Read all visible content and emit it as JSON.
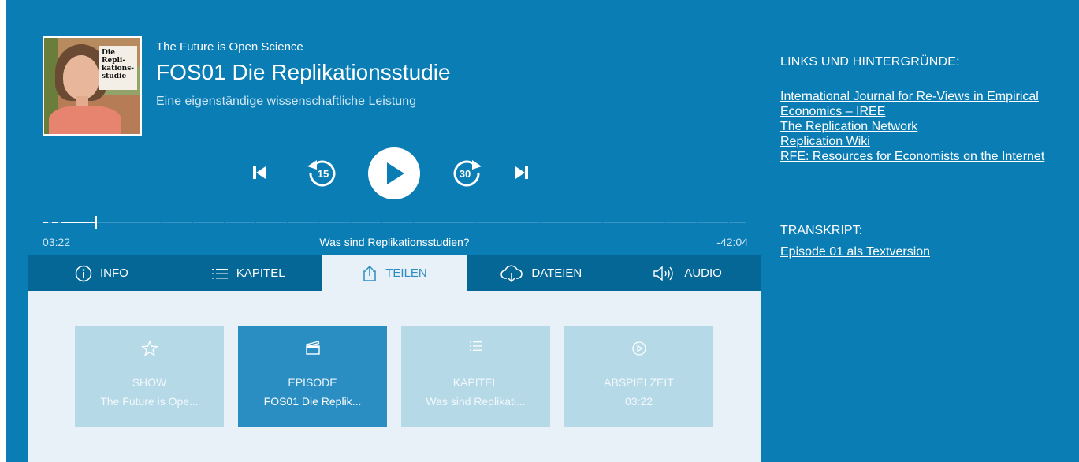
{
  "player": {
    "show_title": "The Future is Open Science",
    "episode_title": "FOS01 Die Replikationsstudie",
    "episode_subtitle": "Eine eigenständige wissenschaftliche Leistung",
    "cover_label": "Die Repli-kations-studie",
    "skip_back_seconds": "15",
    "skip_forward_seconds": "30",
    "progress": {
      "current_time": "03:22",
      "remaining_time": "-42:04",
      "chapter_title": "Was sind Replikationsstudien?",
      "played_fraction": 0.075
    },
    "tabs": [
      {
        "label": "INFO",
        "icon": "info-icon"
      },
      {
        "label": "KAPITEL",
        "icon": "list-icon"
      },
      {
        "label": "TEILEN",
        "icon": "share-icon",
        "active": true
      },
      {
        "label": "DATEIEN",
        "icon": "cloud-download-icon"
      },
      {
        "label": "AUDIO",
        "icon": "speaker-icon"
      }
    ],
    "share_cards": [
      {
        "label": "SHOW",
        "value": "The Future is Ope...",
        "icon": "star-icon"
      },
      {
        "label": "EPISODE",
        "value": "FOS01 Die Replik...",
        "icon": "clapperboard-icon",
        "active": true
      },
      {
        "label": "KAPITEL",
        "value": "Was sind Replikati...",
        "icon": "list-icon"
      },
      {
        "label": "ABSPIELZEIT",
        "value": "03:22",
        "icon": "play-circle-icon"
      }
    ]
  },
  "sidebar": {
    "links_heading": "LINKS UND HINTERGRÜNDE:",
    "links": [
      "International Journal for Re-Views in Empirical Economics – IREE",
      "The Replication Network",
      "Replication Wiki",
      "RFE: Resources for Economists on the Internet"
    ],
    "transcript_heading": "TRANSKRIPT:",
    "transcript_link": "Episode 01 als Textversion"
  },
  "colors": {
    "background": "#0a7db5",
    "tabbar": "#046796",
    "panel": "#e8f1f7",
    "accent": "#2b8ec2",
    "card": "#b6d9e8"
  }
}
